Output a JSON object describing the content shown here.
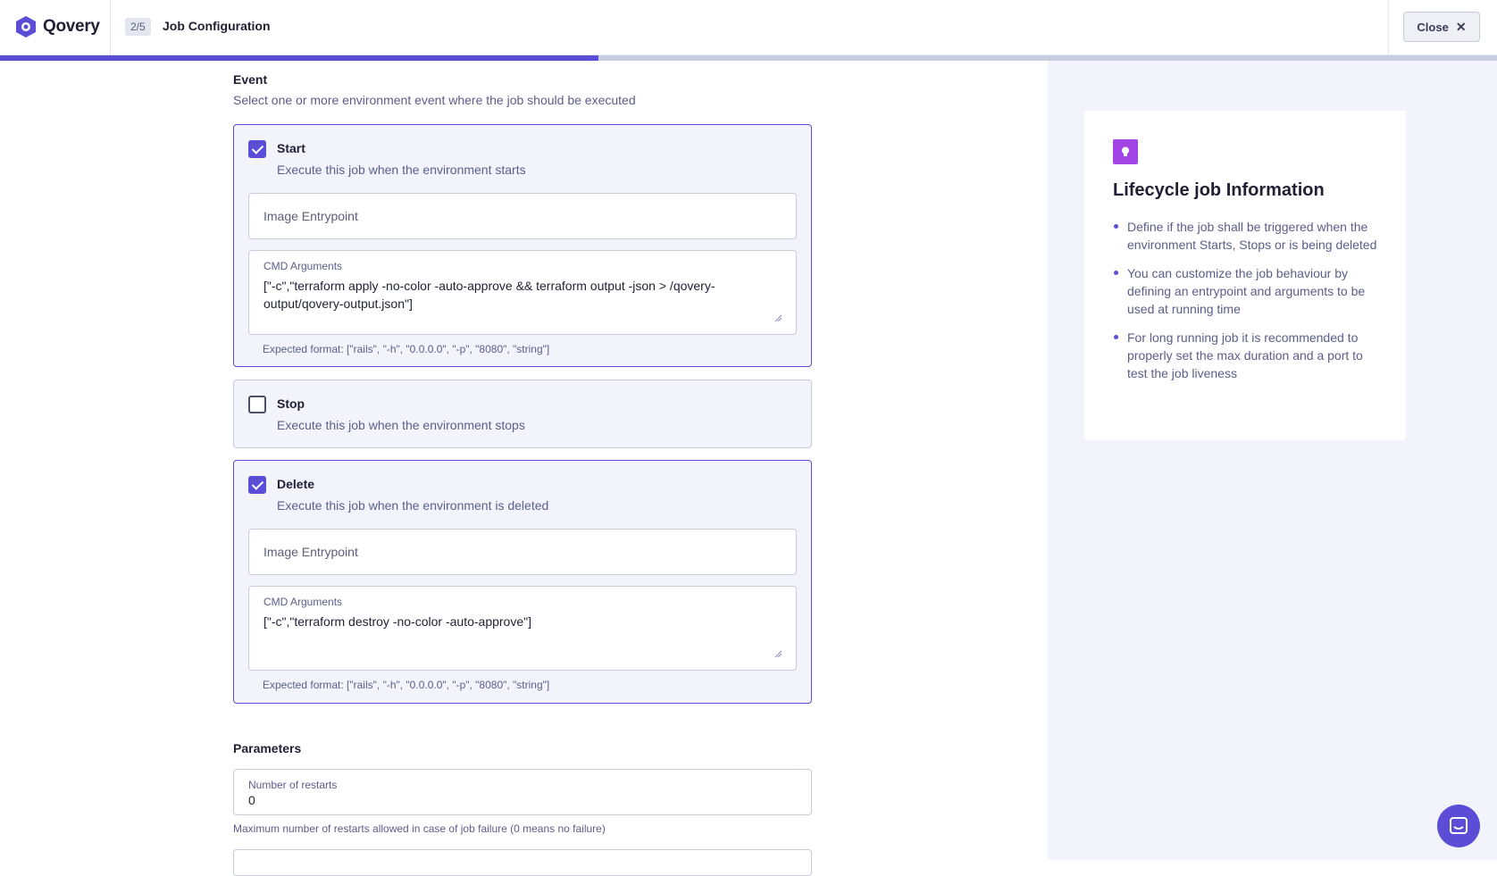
{
  "header": {
    "logo_text": "Qovery",
    "step": "2/5",
    "title": "Job Configuration",
    "close_label": "Close",
    "close_icon": "close-icon"
  },
  "progress": {
    "fraction": 0.4
  },
  "event": {
    "title": "Event",
    "subtitle": "Select one or more environment event where the job should be executed",
    "cards": [
      {
        "title": "Start",
        "description": "Execute this job when the environment starts",
        "checked": true,
        "entrypoint_placeholder": "Image Entrypoint",
        "cmd_label": "CMD Arguments",
        "cmd_value": "[\"-c\",\"terraform apply -no-color -auto-approve && terraform output -json > /qovery-output/qovery-output.json\"]",
        "hint": "Expected format: [\"rails\", \"-h\", \"0.0.0.0\", \"-p\", \"8080\", \"string\"]"
      },
      {
        "title": "Stop",
        "description": "Execute this job when the environment stops",
        "checked": false
      },
      {
        "title": "Delete",
        "description": "Execute this job when the environment is deleted",
        "checked": true,
        "entrypoint_placeholder": "Image Entrypoint",
        "cmd_label": "CMD Arguments",
        "cmd_value": "[\"-c\",\"terraform destroy -no-color -auto-approve\"]",
        "hint": "Expected format: [\"rails\", \"-h\", \"0.0.0.0\", \"-p\", \"8080\", \"string\"]"
      }
    ]
  },
  "parameters": {
    "title": "Parameters",
    "restarts_label": "Number of restarts",
    "restarts_value": "0",
    "restarts_hint": "Maximum number of restarts allowed in case of job failure (0 means no failure)"
  },
  "info": {
    "icon": "lightbulb-icon",
    "title": "Lifecycle job Information",
    "items": [
      "Define if the job shall be triggered when the environment Starts, Stops or is being deleted",
      "You can customize the job behaviour by defining an entrypoint and arguments to be used at running time",
      "For long running job it is recommended to properly set the max duration and a port to test the job liveness"
    ]
  },
  "colors": {
    "accent": "#5b4dd6",
    "info_icon_bg": "#a144e6",
    "side_bg": "#f3f4fb"
  }
}
